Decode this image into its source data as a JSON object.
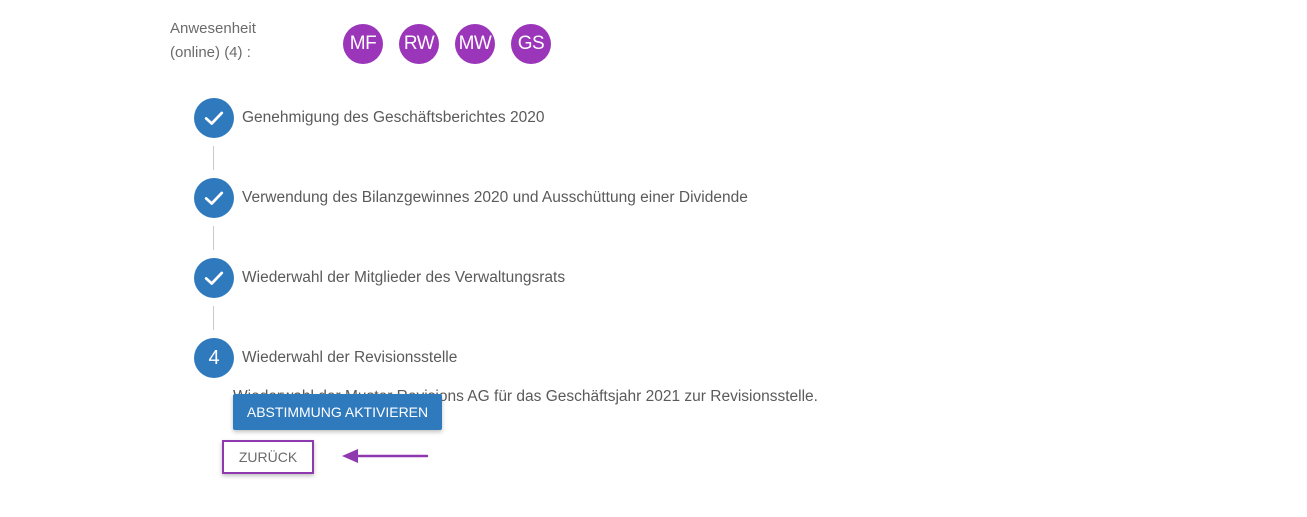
{
  "attendance": {
    "label": "Anwesenheit (online) (4) :",
    "participants": [
      "MF",
      "RW",
      "MW",
      "GS"
    ]
  },
  "steps": [
    {
      "status": "done",
      "icon": "check-icon",
      "label": "Genehmigung des Geschäftsberichtes 2020"
    },
    {
      "status": "done",
      "icon": "check-icon",
      "label": "Verwendung des Bilanzgewinnes 2020 und Ausschüttung einer Dividende"
    },
    {
      "status": "done",
      "icon": "check-icon",
      "label": "Wiederwahl der Mitglieder des Verwaltungsrats"
    },
    {
      "status": "active",
      "number": "4",
      "label": "Wiederwahl der Revisionsstelle"
    }
  ],
  "active_step": {
    "description": "Wiederwahl der Muster Revisions AG für das Geschäftsjahr 2021 zur Revisionsstelle."
  },
  "actions": {
    "activate_label": "ABSTIMMUNG AKTIVIEREN",
    "back_label": "ZURÜCK"
  },
  "colors": {
    "avatar": "#9b35b9",
    "step": "#2f79bd",
    "highlight": "#8e39b0"
  }
}
